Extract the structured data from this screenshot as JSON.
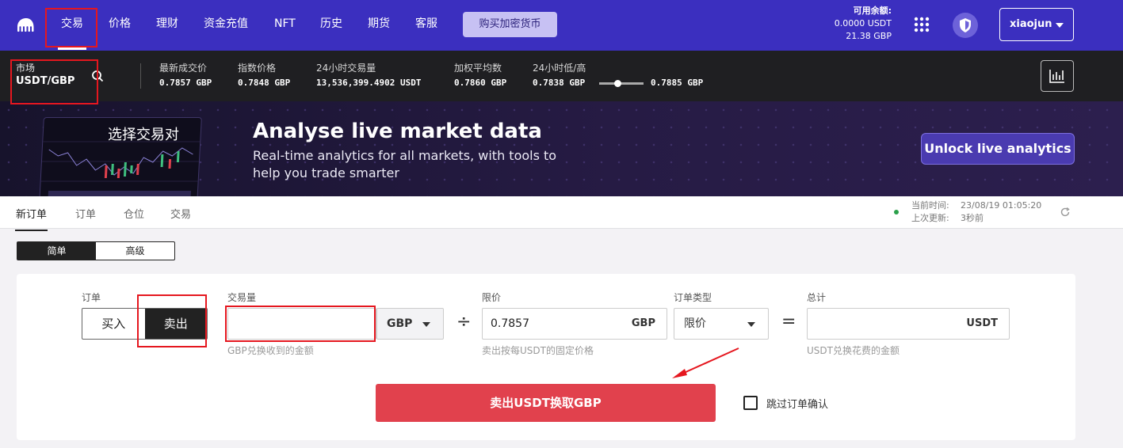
{
  "nav": {
    "items": [
      {
        "label": "交易",
        "active": true
      },
      {
        "label": "价格"
      },
      {
        "label": "理财"
      },
      {
        "label": "资金充值"
      },
      {
        "label": "NFT"
      },
      {
        "label": "历史"
      },
      {
        "label": "期货"
      },
      {
        "label": "客服"
      }
    ],
    "buy_crypto": "购买加密货币",
    "balance_title": "可用余额:",
    "balance_usdt": "0.0000 USDT",
    "balance_gbp": "21.38 GBP",
    "username": "xiaojun",
    "icons": [
      "kraken-logo-icon",
      "grid-apps-icon",
      "shield-icon",
      "chevron-down-icon"
    ]
  },
  "market": {
    "label": "市场",
    "pair": "USDT/GBP",
    "stats": [
      {
        "label": "最新成交价",
        "value": "0.7857 GBP"
      },
      {
        "label": "指数价格",
        "value": "0.7848 GBP"
      },
      {
        "label": "24小时交易量",
        "value": "13,536,399.4902 USDT"
      },
      {
        "label": "加权平均数",
        "value": "0.7860 GBP"
      },
      {
        "label": "24小时低/高",
        "value": "0.7838 GBP"
      }
    ],
    "high": "0.7885 GBP",
    "range_position": 0.4
  },
  "banner": {
    "preview_title": "选择交易对",
    "heading": "Analyse live market data",
    "subtitle": "Real-time analytics for all markets, with tools to help you trade smarter",
    "cta": "Unlock live analytics"
  },
  "order_tabs": [
    "新订单",
    "订单",
    "仓位",
    "交易"
  ],
  "time": {
    "current_label": "当前时间:",
    "current_value": "23/08/19 01:05:20",
    "updated_label": "上次更新:",
    "updated_value": "3秒前"
  },
  "mode": {
    "simple": "简单",
    "advanced": "高级"
  },
  "form": {
    "order_label": "订单",
    "buy": "买入",
    "sell": "卖出",
    "amount_label": "交易量",
    "amount_value": "",
    "amount_unit": "GBP",
    "amount_hint": "GBP兑换收到的金额",
    "divide": "÷",
    "limit_label": "限价",
    "limit_value": "0.7857",
    "limit_unit": "GBP",
    "limit_hint": "卖出按每USDT的固定价格",
    "order_type_label": "订单类型",
    "order_type_value": "限价",
    "equals": "=",
    "total_label": "总计",
    "total_value": "",
    "total_unit": "USDT",
    "total_hint": "USDT兑换花费的金额",
    "submit": "卖出USDT换取GBP",
    "skip_confirm": "跳过订单确认"
  },
  "colors": {
    "nav_bg": "#3b2fbf",
    "sell_button": "#e1414d",
    "annotation": "#e5171f"
  }
}
